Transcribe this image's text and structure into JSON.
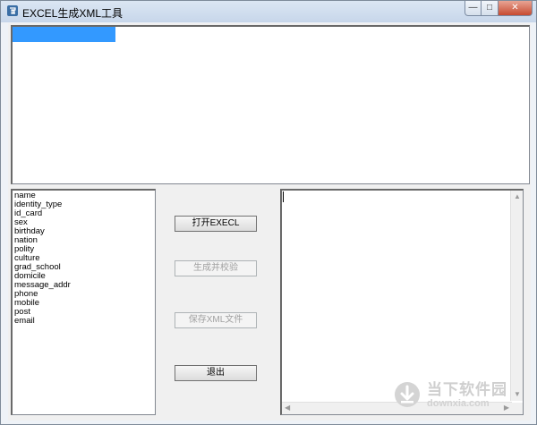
{
  "window": {
    "title": "EXCEL生成XML工具",
    "controls": {
      "minimize": "—",
      "maximize": "□",
      "close": "✕"
    }
  },
  "field_list": {
    "items": [
      "name",
      "identity_type",
      "id_card",
      "sex",
      "birthday",
      "nation",
      "polity",
      "culture",
      "grad_school",
      "domicile",
      "message_addr",
      "phone",
      "mobile",
      "post",
      "email"
    ]
  },
  "buttons": {
    "open_excel": "打开EXECL",
    "generate_validate": "生成并校验",
    "save_xml": "保存XML文件",
    "exit": "退出"
  },
  "watermark": {
    "brand": "当下软件园",
    "domain": "downxia.com"
  },
  "icons": {
    "app": "app-logo-icon",
    "watermark": "download-arrow-icon"
  }
}
